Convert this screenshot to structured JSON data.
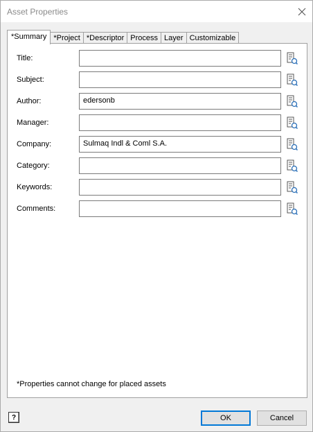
{
  "window": {
    "title": "Asset Properties"
  },
  "tabs": [
    {
      "label": "*Summary",
      "active": true
    },
    {
      "label": "*Project",
      "active": false
    },
    {
      "label": "*Descriptor",
      "active": false
    },
    {
      "label": "Process",
      "active": false
    },
    {
      "label": "Layer",
      "active": false
    },
    {
      "label": "Customizable",
      "active": false
    }
  ],
  "fields": [
    {
      "label": "Title:",
      "value": ""
    },
    {
      "label": "Subject:",
      "value": ""
    },
    {
      "label": "Author:",
      "value": "edersonb"
    },
    {
      "label": "Manager:",
      "value": ""
    },
    {
      "label": "Company:",
      "value": "Sulmaq Indl & Coml S.A."
    },
    {
      "label": "Category:",
      "value": ""
    },
    {
      "label": "Keywords:",
      "value": ""
    },
    {
      "label": "Comments:",
      "value": ""
    }
  ],
  "footnote": "*Properties cannot change for placed assets",
  "buttons": {
    "help": "?",
    "ok": "OK",
    "cancel": "Cancel"
  },
  "icons": {
    "close": "close-icon",
    "field_property": "property-lookup-icon",
    "help": "help-icon"
  },
  "colors": {
    "accent": "#0078d7",
    "title_text": "#8a8a8a"
  }
}
